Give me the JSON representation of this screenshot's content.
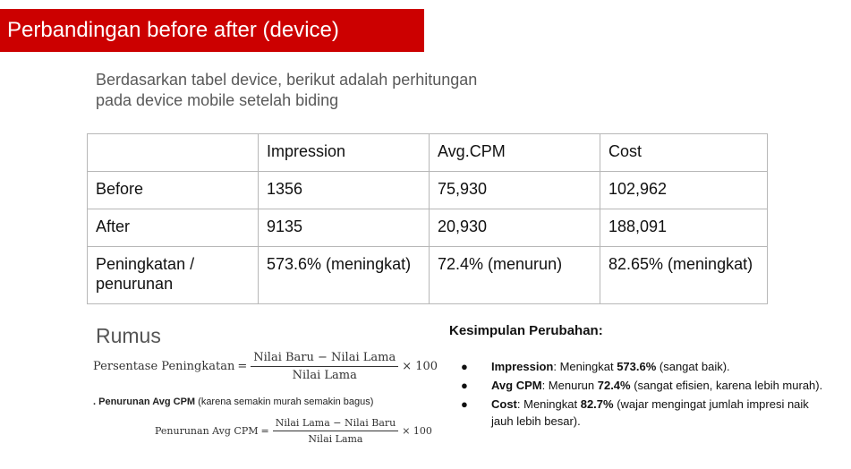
{
  "header": {
    "title": "Perbandingan before after (device)"
  },
  "intro": {
    "line1": "Berdasarkan tabel device, berikut adalah perhitungan",
    "line2": "pada device mobile setelah biding"
  },
  "table": {
    "headers": [
      "",
      "Impression",
      "Avg.CPM",
      "Cost"
    ],
    "rows": [
      [
        "Before",
        "1356",
        "75,930",
        "102,962"
      ],
      [
        "After",
        "9135",
        "20,930",
        "188,091"
      ],
      [
        "Peningkatan / penurunan",
        "573.6% (meningkat)",
        "72.4% (menurun)",
        "82.65% (meningkat)"
      ]
    ]
  },
  "rumus": {
    "title": "Rumus",
    "f1": {
      "lhs": "Persentase Peningkatan",
      "eq": "=",
      "num": "Nilai Baru − Nilai Lama",
      "den": "Nilai Lama",
      "tail": "× 100"
    },
    "note_bold": ". Penurunan Avg CPM",
    "note_rest": " (karena semakin murah semakin bagus)",
    "f2": {
      "lhs": "Penurunan Avg CPM",
      "eq": "=",
      "num": "Nilai Lama − Nilai Baru",
      "den": "Nilai Lama",
      "tail": "× 100"
    }
  },
  "kesimpulan": {
    "title": "Kesimpulan Perubahan:",
    "bullet": "●",
    "items": [
      {
        "label": "Impression",
        "pre": ": Meningkat ",
        "value": "573.6%",
        "post": " (sangat baik)."
      },
      {
        "label": "Avg CPM",
        "pre": ": Menurun ",
        "value": "72.4%",
        "post": " (sangat efisien, karena lebih murah)."
      },
      {
        "label": "Cost",
        "pre": ": Meningkat ",
        "value": "82.7%",
        "post": " (wajar mengingat jumlah impresi naik jauh lebih besar)."
      }
    ]
  }
}
